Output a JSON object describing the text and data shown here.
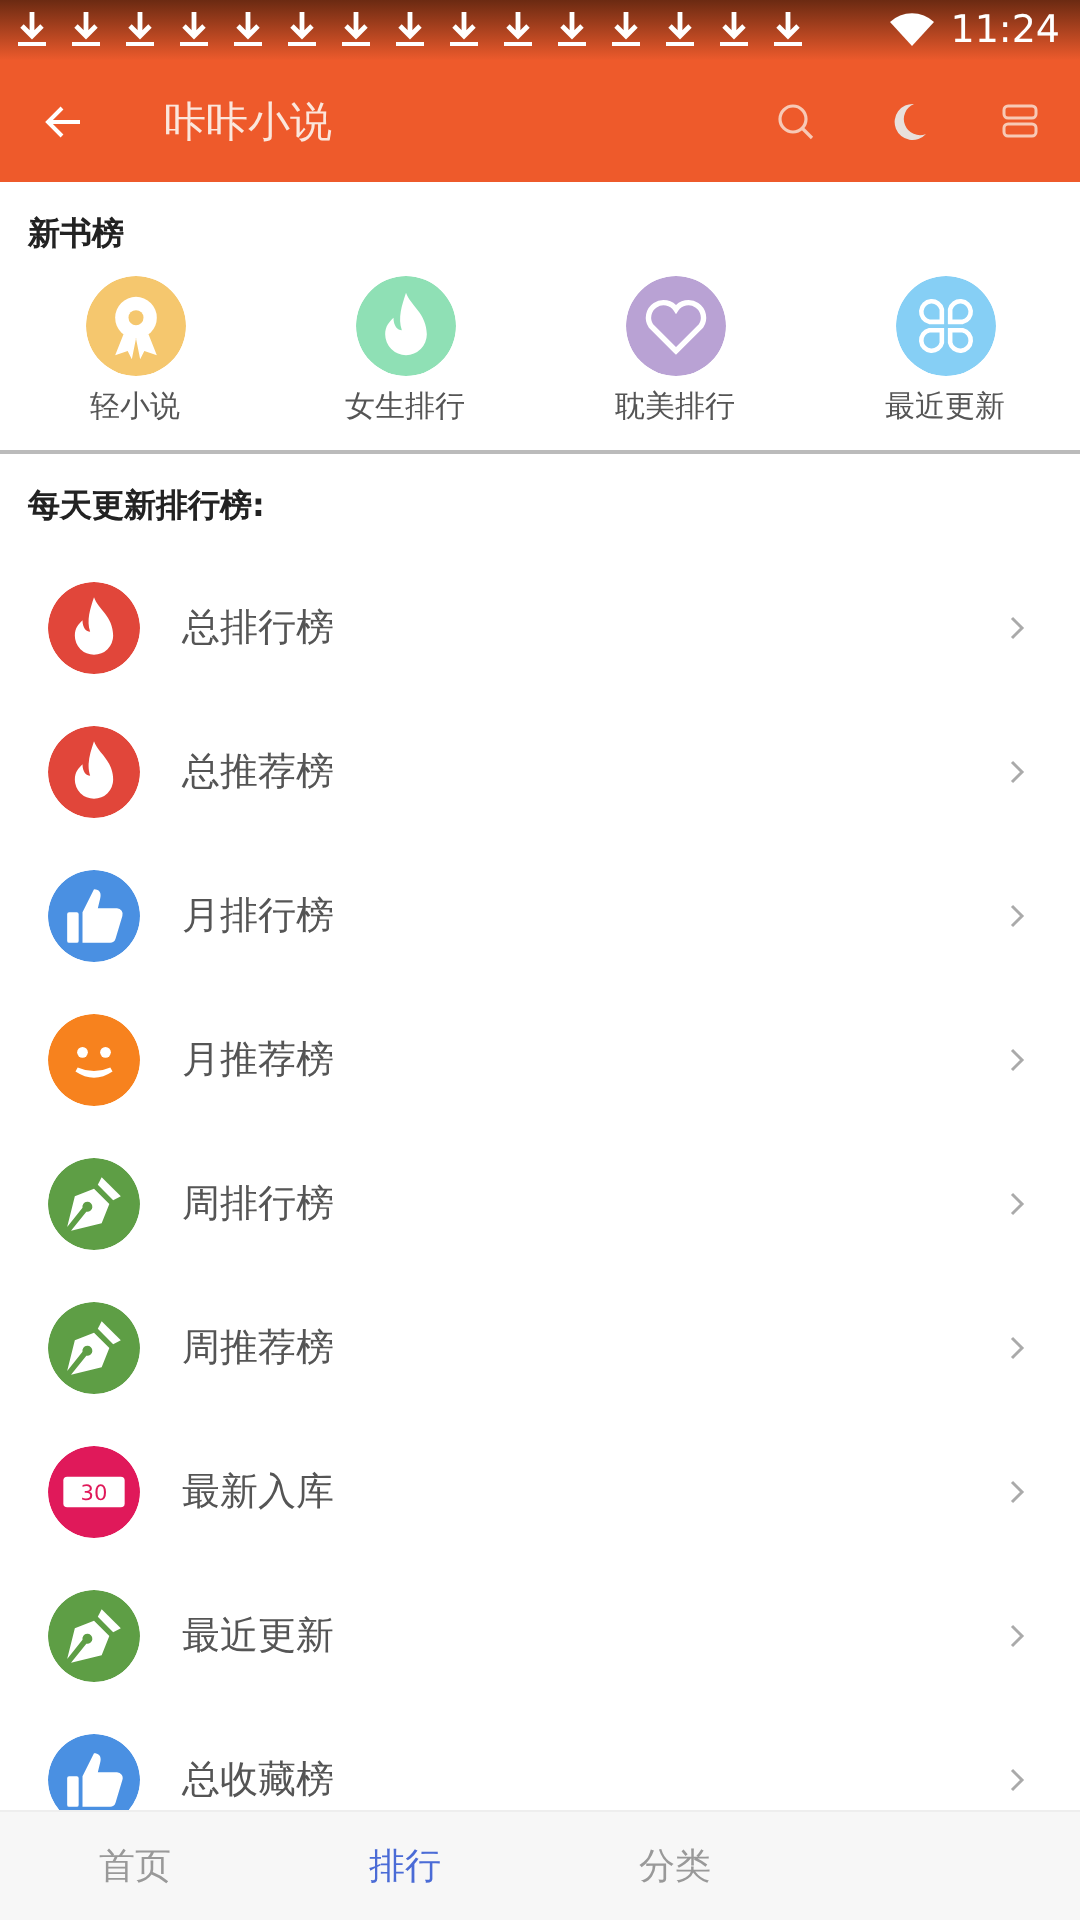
{
  "status_bar": {
    "notifications": [
      {
        "kind": "download"
      },
      {
        "kind": "download"
      },
      {
        "kind": "download"
      },
      {
        "kind": "download"
      },
      {
        "kind": "download"
      },
      {
        "kind": "download"
      },
      {
        "kind": "download"
      },
      {
        "kind": "download"
      },
      {
        "kind": "download"
      },
      {
        "kind": "download"
      },
      {
        "kind": "download"
      },
      {
        "kind": "download"
      },
      {
        "kind": "download"
      },
      {
        "kind": "download"
      },
      {
        "kind": "download"
      }
    ],
    "time": "11:24"
  },
  "app_bar": {
    "title": "咔咔小说"
  },
  "new_books": {
    "title": "新书榜",
    "items": [
      {
        "label": "轻小说",
        "kind": "medal",
        "color": "#f5c76e"
      },
      {
        "label": "女生排行",
        "kind": "flame",
        "color": "#8fe0b5"
      },
      {
        "label": "耽美排行",
        "kind": "heart",
        "color": "#b9a2d4"
      },
      {
        "label": "最近更新",
        "kind": "clover",
        "color": "#86cff5"
      }
    ]
  },
  "rankings": {
    "title": "每天更新排行榜:",
    "rows": [
      {
        "label": "总排行榜",
        "kind": "flame",
        "color": "#e1463a"
      },
      {
        "label": "总推荐榜",
        "kind": "flame",
        "color": "#e1463a"
      },
      {
        "label": "月排行榜",
        "kind": "thumb",
        "color": "#4a90e2"
      },
      {
        "label": "月推荐榜",
        "kind": "smile",
        "color": "#f7821e"
      },
      {
        "label": "周排行榜",
        "kind": "pen",
        "color": "#5e9e45"
      },
      {
        "label": "周推荐榜",
        "kind": "pen",
        "color": "#5e9e45"
      },
      {
        "label": "最新入库",
        "kind": "ticket",
        "color": "#e0195a",
        "icon_text": "30"
      },
      {
        "label": "最近更新",
        "kind": "pen",
        "color": "#5e9e45"
      },
      {
        "label": "总收藏榜",
        "kind": "thumb",
        "color": "#4a90e2"
      }
    ]
  },
  "bottom_nav": [
    {
      "label": "首页",
      "selected": false
    },
    {
      "label": "排行",
      "selected": true
    },
    {
      "label": "分类",
      "selected": false
    }
  ]
}
